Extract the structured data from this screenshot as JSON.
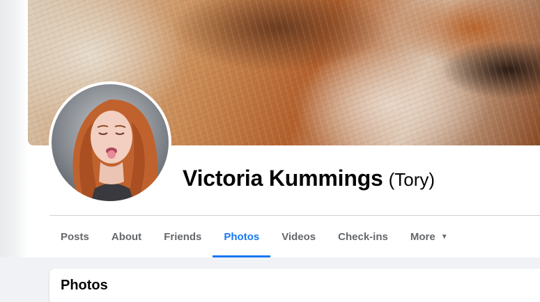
{
  "profile": {
    "name": "Victoria Kummings",
    "alternate_name": "(Tory)"
  },
  "tabs": [
    {
      "label": "Posts",
      "active": false
    },
    {
      "label": "About",
      "active": false
    },
    {
      "label": "Friends",
      "active": false
    },
    {
      "label": "Photos",
      "active": true
    },
    {
      "label": "Videos",
      "active": false
    },
    {
      "label": "Check-ins",
      "active": false
    },
    {
      "label": "More",
      "active": false
    }
  ],
  "section": {
    "title": "Photos"
  },
  "colors": {
    "accent": "#1877f2",
    "tab_inactive": "#65676b",
    "text_primary": "#050505",
    "page_bg": "#f0f2f5"
  },
  "icons": {
    "more_caret": "caret-down-icon"
  }
}
